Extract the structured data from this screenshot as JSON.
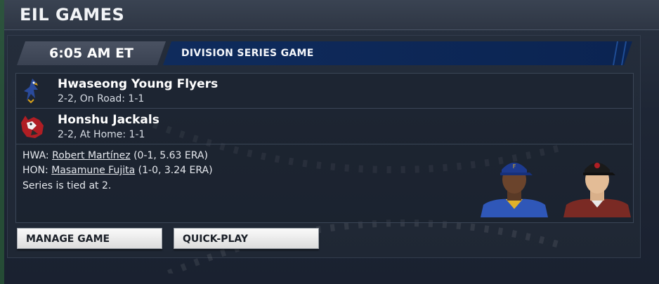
{
  "window": {
    "title": "EIL GAMES"
  },
  "game_header": {
    "time": "6:05 AM ET",
    "series_label": "DIVISION SERIES GAME"
  },
  "teams": [
    {
      "name": "Hwaseong Young Flyers",
      "record": "2-2, On Road: 1-1",
      "logo": "flyers-logo-icon"
    },
    {
      "name": "Honshu Jackals",
      "record": "2-2, At Home: 1-1",
      "logo": "jackals-logo-icon"
    }
  ],
  "pitchers": [
    {
      "team": "HWA:",
      "name": "Robert Martínez",
      "stats": "(0-1, 5.63 ERA)"
    },
    {
      "team": "HON:",
      "name": "Masamune Fujita",
      "stats": "(1-0, 3.24 ERA)"
    }
  ],
  "series_status": "Series is tied at 2.",
  "buttons": {
    "manage": "MANAGE GAME",
    "quickplay": "QUICK-PLAY"
  },
  "colors": {
    "header_blue": "#0b2452",
    "flyers_cap": "#1d3a8f",
    "jackals_cap": "#1a1a1a"
  }
}
